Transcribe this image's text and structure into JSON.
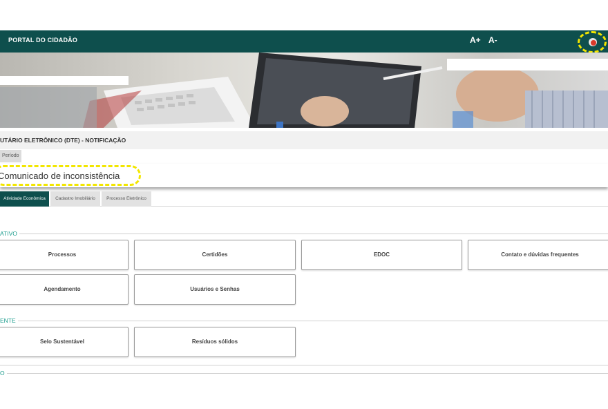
{
  "topbar": {
    "title": "PORTAL DO CIDADÃO",
    "font_increase": "A+",
    "font_decrease": "A-",
    "user_icon": "user-avatar-icon"
  },
  "banner": {
    "icon": "hero-photo-tablet-keyboard"
  },
  "subheader": {
    "label": "UTÁRIO ELETRÔNICO (DTE) - NOTIFICAÇÃO"
  },
  "periodo_tab": "Período",
  "notice": {
    "text": "Comunicado de inconsistência"
  },
  "tabs": [
    {
      "label": "Atividade Econômica",
      "active": true
    },
    {
      "label": "Cadastro Imobiliário",
      "active": false
    },
    {
      "label": "Processo Eletrônico",
      "active": false
    }
  ],
  "sections": [
    {
      "label": "ATIVO",
      "cards": [
        "Processos",
        "Certidões",
        "EDOC",
        "Contato e dúvidas frequentes",
        "Agendamento",
        "Usuários e Senhas"
      ]
    },
    {
      "label": "ENTE",
      "cards": [
        "Selo Sustentável",
        "Resíduos sólidos"
      ]
    },
    {
      "label": "O",
      "cards": []
    }
  ],
  "colors": {
    "primary": "#0e4f4d",
    "accent": "#1a9b8c",
    "highlight": "#f2e600"
  }
}
